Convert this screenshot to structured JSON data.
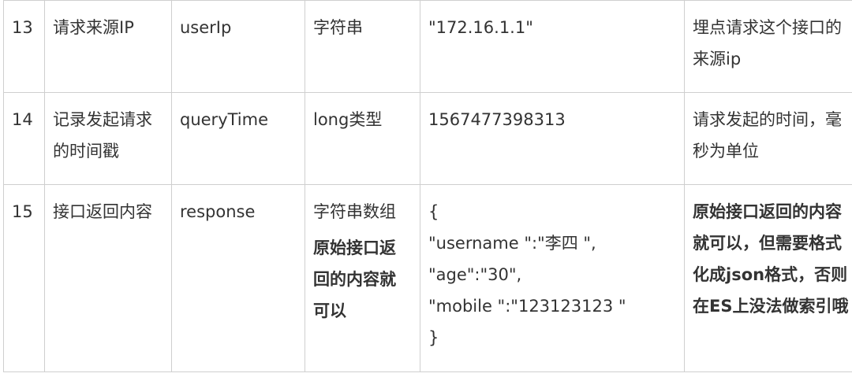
{
  "rows": [
    {
      "num": "13",
      "name": "请求来源IP",
      "field": "userIp",
      "type": "字符串",
      "example": "\"172.16.1.1\"",
      "desc": "埋点请求这个接口的来源ip"
    },
    {
      "num": "14",
      "name": "记录发起请求的时间戳",
      "field": "queryTime",
      "type": "long类型",
      "example": "1567477398313",
      "desc": "请求发起的时间，毫秒为单位"
    },
    {
      "num": "15",
      "name": "接口返回内容",
      "field": "response",
      "type": "字符串数组",
      "type_note": "原始接口返回的内容就可以",
      "example_lines": [
        "{",
        "\"username \":\"李四 \",",
        "\"age\":\"30\",",
        "\"mobile \":\"123123123 \"",
        "}"
      ],
      "desc": "原始接口返回的内容就可以，但需要格式化成json格式，否则在ES上没法做索引哦"
    }
  ]
}
